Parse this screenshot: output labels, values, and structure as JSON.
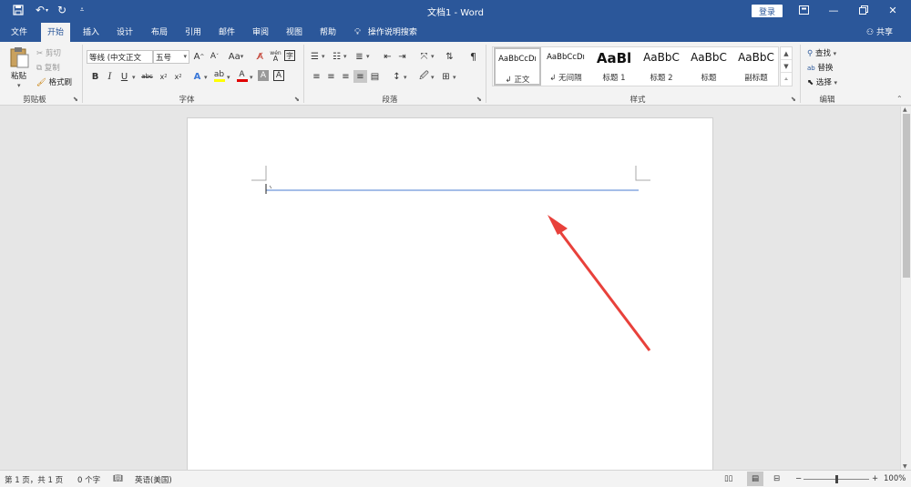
{
  "window": {
    "title": "文档1  -  Word",
    "login_label": "登录"
  },
  "colors": {
    "brand": "#2b579a",
    "accent_line": "#4a7bd0",
    "arrow": "#e8413b",
    "highlight": "#ffff00",
    "font_color": "#e00000"
  },
  "tabs": [
    "文件",
    "开始",
    "插入",
    "设计",
    "布局",
    "引用",
    "邮件",
    "审阅",
    "视图",
    "帮助"
  ],
  "tell_me": {
    "icon": "lightbulb-icon",
    "label": "操作说明搜索"
  },
  "share_label": "共享",
  "clipboard": {
    "paste": "粘贴",
    "cut": "剪切",
    "copy": "复制",
    "format_painter": "格式刷",
    "label": "剪贴板"
  },
  "font": {
    "name": "等线 (中文正文",
    "size": "五号",
    "label": "字体",
    "wen_char": "wén",
    "A_char": "A",
    "case_char": "Aa",
    "char_border": "A",
    "enclose_char": "字"
  },
  "paragraph": {
    "label": "段落"
  },
  "styles": {
    "label": "样式",
    "items": [
      {
        "preview": "AaBbCcDı",
        "name": "↲ 正文"
      },
      {
        "preview": "AaBbCcDı",
        "name": "↲ 无间隔"
      },
      {
        "preview": "AaBl",
        "name": "标题 1"
      },
      {
        "preview": "AaBbC",
        "name": "标题 2"
      },
      {
        "preview": "AaBbC",
        "name": "标题"
      },
      {
        "preview": "AaBbC",
        "name": "副标题"
      }
    ]
  },
  "editing": {
    "find": "查找",
    "replace": "替换",
    "select": "选择",
    "label": "编辑"
  },
  "status": {
    "page": "第 1 页，共 1 页",
    "words": "0 个字",
    "language": "英语(美国)",
    "zoom": "100%",
    "zoom_level": 1.0
  },
  "icons": [
    "save-icon",
    "undo-icon",
    "redo-icon",
    "customize-icon",
    "restore-ribbon-icon",
    "minimize-icon",
    "maximize-icon",
    "close-icon",
    "person-icon"
  ]
}
